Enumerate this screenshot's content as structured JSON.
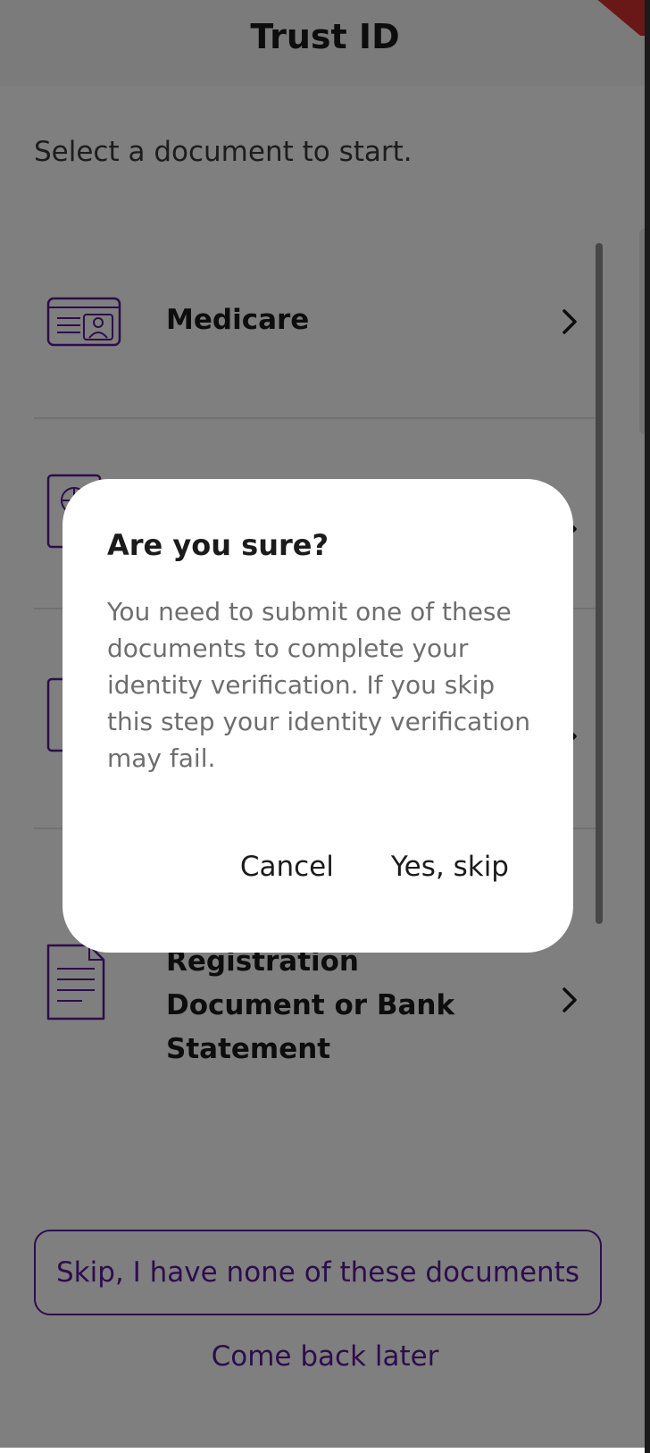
{
  "header": {
    "title": "Trust ID"
  },
  "intro": {
    "text": "Select a document to start."
  },
  "documents": [
    {
      "label": "Medicare",
      "icon": "id-card-icon"
    },
    {
      "label": "",
      "icon": "passport-icon"
    },
    {
      "label": "",
      "icon": "license-icon"
    },
    {
      "label_line1": "Registration",
      "label_line2": "Document or Bank",
      "label_line3": "Statement",
      "icon": "document-icon"
    }
  ],
  "footer": {
    "skip_label": "Skip, I have none of these documents",
    "later_label": "Come back later"
  },
  "dialog": {
    "title": "Are you sure?",
    "body": "You need to submit one of these documents to complete your identity verification. If you skip this step your identity verification may fail.",
    "cancel_label": "Cancel",
    "confirm_label": "Yes, skip"
  },
  "colors": {
    "accent": "#5b1a99",
    "overlay": "rgba(0,0,0,0.5)"
  }
}
